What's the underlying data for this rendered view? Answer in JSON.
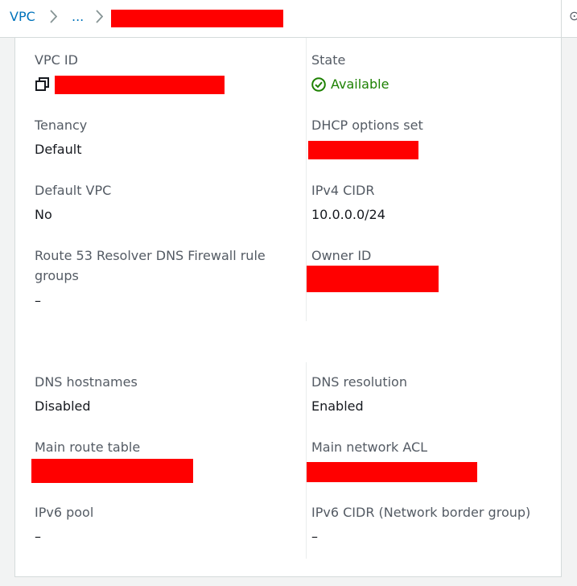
{
  "breadcrumb": {
    "root": "VPC",
    "ellipsis": "..."
  },
  "details": {
    "vpc_id_label": "VPC ID",
    "state_label": "State",
    "state_value": "Available",
    "tenancy_label": "Tenancy",
    "tenancy_value": "Default",
    "dhcp_label": "DHCP options set",
    "default_vpc_label": "Default VPC",
    "default_vpc_value": "No",
    "ipv4_cidr_label": "IPv4 CIDR",
    "ipv4_cidr_value": "10.0.0.0/24",
    "route53_label": "Route 53 Resolver DNS Firewall rule groups",
    "route53_value": "–",
    "owner_id_label": "Owner ID",
    "dns_hostnames_label": "DNS hostnames",
    "dns_hostnames_value": "Disabled",
    "dns_resolution_label": "DNS resolution",
    "dns_resolution_value": "Enabled",
    "main_route_table_label": "Main route table",
    "main_network_acl_label": "Main network ACL",
    "ipv6_pool_label": "IPv6 pool",
    "ipv6_pool_value": "–",
    "ipv6_cidr_label": "IPv6 CIDR (Network border group)",
    "ipv6_cidr_value": "–"
  },
  "colors": {
    "link": "#0073bb",
    "success": "#1d8102",
    "redaction": "#ff0000"
  },
  "icons": {
    "copy": "copy-icon",
    "status": "check-circle-icon",
    "separator": "chevron-right-icon"
  }
}
